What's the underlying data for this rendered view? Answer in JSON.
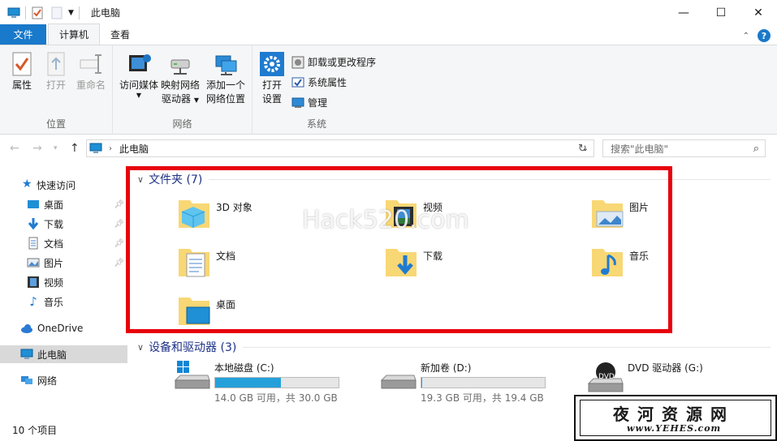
{
  "window": {
    "title": "此电脑",
    "controls": [
      "—",
      "☐",
      "✕"
    ]
  },
  "tabs": [
    {
      "label": "文件"
    },
    {
      "label": "计算机"
    },
    {
      "label": "查看"
    }
  ],
  "ribbon": {
    "location": {
      "label": "位置",
      "properties": "属性",
      "open": "打开",
      "rename": "重命名"
    },
    "network": {
      "label": "网络",
      "access_media": "访问媒体",
      "map_drive_1": "映射网络",
      "map_drive_2": "驱动器",
      "add_location_1": "添加一个",
      "add_location_2": "网络位置"
    },
    "system": {
      "label": "系统",
      "open_settings_1": "打开",
      "open_settings_2": "设置",
      "uninstall": "卸载或更改程序",
      "sys_props": "系统属性",
      "manage": "管理"
    }
  },
  "address": {
    "path": "此电脑",
    "search_placeholder": "搜索\"此电脑\""
  },
  "sidebar": {
    "quick_access": "快速访问",
    "items": [
      {
        "label": "桌面"
      },
      {
        "label": "下载"
      },
      {
        "label": "文档"
      },
      {
        "label": "图片"
      },
      {
        "label": "视频"
      },
      {
        "label": "音乐"
      }
    ],
    "onedrive": "OneDrive",
    "this_pc": "此电脑",
    "network": "网络"
  },
  "folders_section": {
    "title": "文件夹 (7)",
    "folders": [
      {
        "name": "3D 对象"
      },
      {
        "name": "视频"
      },
      {
        "name": "图片"
      },
      {
        "name": "文档"
      },
      {
        "name": "下载"
      },
      {
        "name": "音乐"
      },
      {
        "name": "桌面"
      }
    ]
  },
  "drives_section": {
    "title": "设备和驱动器 (3)",
    "drives": [
      {
        "name": "本地磁盘 (C:)",
        "free": "14.0 GB 可用，共 30.0 GB",
        "used_fraction": 0.53
      },
      {
        "name": "新加卷 (D:)",
        "free": "19.3 GB 可用，共 19.4 GB",
        "used_fraction": 0.005
      },
      {
        "name": "DVD 驱动器 (G:)",
        "icon_text": "DVD"
      }
    ]
  },
  "status": {
    "item_count": "10 个项目"
  },
  "watermark": "Hack520.com",
  "stamp": {
    "title": "夜河资源网",
    "url": "www.YEHES.com"
  },
  "colors": {
    "accent": "#1979ca",
    "highlight_box": "#e8000b",
    "section_title": "#1e3287",
    "drive_fill": "#26a0da",
    "folder_yellow": "#f8d775"
  }
}
